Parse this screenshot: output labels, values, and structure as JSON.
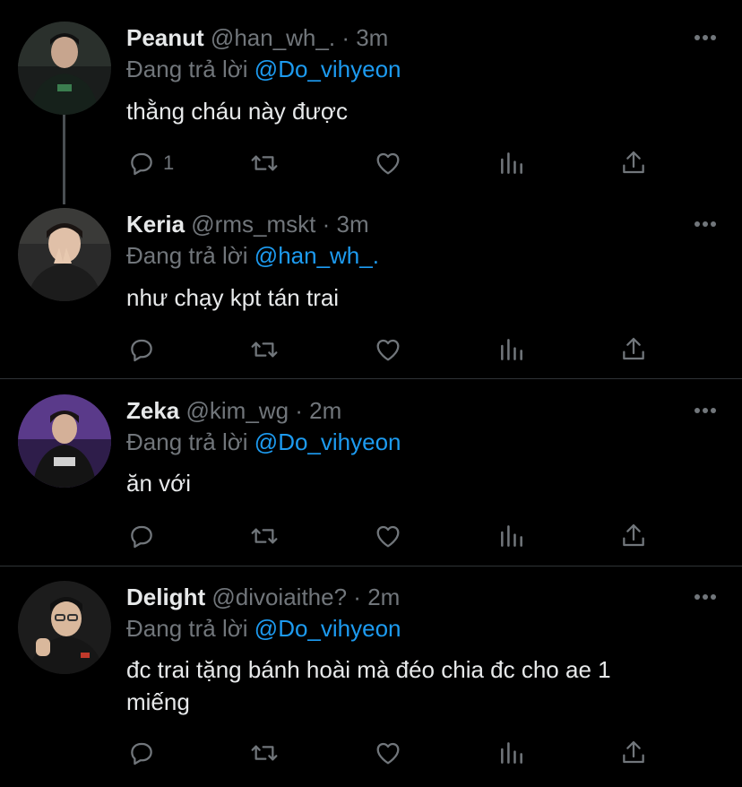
{
  "tweets": [
    {
      "name": "Peanut",
      "handle": "@han_wh_.",
      "time": "3m",
      "reply_prefix": "Đang trả lời",
      "reply_to": "@Do_vihyeon",
      "text": "thằng cháu này được",
      "reply_count": "1"
    },
    {
      "name": "Keria",
      "handle": "@rms_mskt",
      "time": "3m",
      "reply_prefix": "Đang trả lời",
      "reply_to": "@han_wh_.",
      "text": "như chạy kpt tán trai",
      "reply_count": ""
    },
    {
      "name": "Zeka",
      "handle": "@kim_wg",
      "time": "2m",
      "reply_prefix": "Đang trả lời",
      "reply_to": "@Do_vihyeon",
      "text": "ăn với",
      "reply_count": ""
    },
    {
      "name": "Delight",
      "handle": "@divoiaithe?",
      "time": "2m",
      "reply_prefix": "Đang trả lời",
      "reply_to": "@Do_vihyeon",
      "text_lines": [
        "đc trai tặng bánh hoài mà đéo chia đc cho ae 1",
        "miếng"
      ],
      "reply_count": ""
    }
  ],
  "separator": "·",
  "icons": {
    "reply": "reply-icon",
    "retweet": "retweet-icon",
    "like": "like-icon",
    "analytics": "analytics-icon",
    "share": "share-icon",
    "more": "more-icon"
  },
  "colors": {
    "background": "#000000",
    "text": "#e7e9ea",
    "muted": "#71767b",
    "mention": "#1d9bf0",
    "divider": "#2f3336"
  }
}
